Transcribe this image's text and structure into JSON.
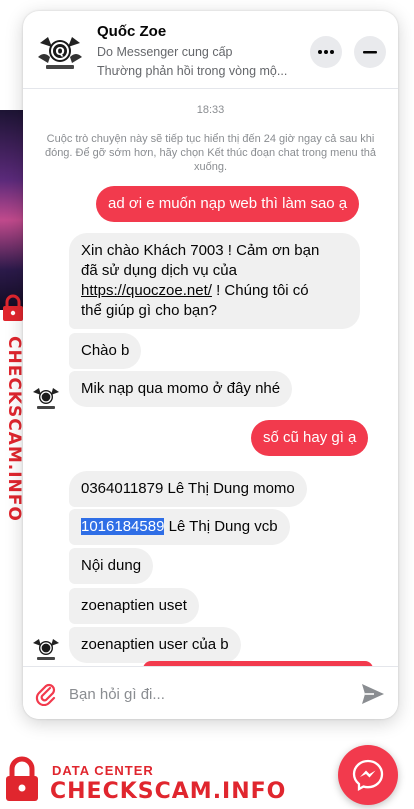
{
  "header": {
    "name": "Quốc Zoe",
    "subtitle": "Do Messenger cung cấp",
    "response": "Thường phản hồi trong vòng mộ..."
  },
  "chat": {
    "time": "18:33",
    "notice": "Cuộc trò chuyện này sẽ tiếp tục hiển thị đến 24 giờ ngay cả sau khi đóng. Để gỡ sớm hơn, hãy chọn Kết thúc đoạn chat trong menu thả xuống.",
    "messages": {
      "m1": "ad ơi e muốn nạp web thì làm sao ạ",
      "m2_l1": "Xin chào Khách 7003 ! Cảm ơn bạn",
      "m2_l2": "đã sử dụng dịch vụ của",
      "m2_link": "https://quoczoe.net/",
      "m2_l3_rest": " ! Chúng tôi có",
      "m2_l4": "thể giúp gì cho bạn?",
      "m3": "Chào b",
      "m4": "Mik nạp qua momo ở đây nhé",
      "m5": "số cũ hay gì ạ",
      "m6": "0364011879 Lê Thị Dung momo",
      "m7_hl": "1016184589",
      "m7_rest": " Lê Thị Dung vcb",
      "m8": "Nội dung",
      "m9": "zoenaptien uset",
      "m10": "zoenaptien user của b"
    }
  },
  "composer": {
    "placeholder": "Bạn hỏi gì đi..."
  },
  "watermark": {
    "sub": "DATA CENTER",
    "main": "CHECKSCAM.INFO"
  },
  "colors": {
    "accent": "#f23a4d",
    "watermark": "#e0262e",
    "incoming_bg": "#f0f0f0"
  },
  "icons": [
    "quoczoe-logo-icon",
    "more-icon",
    "minimize-icon",
    "attachment-icon",
    "send-icon",
    "messenger-icon",
    "lock-icon"
  ]
}
